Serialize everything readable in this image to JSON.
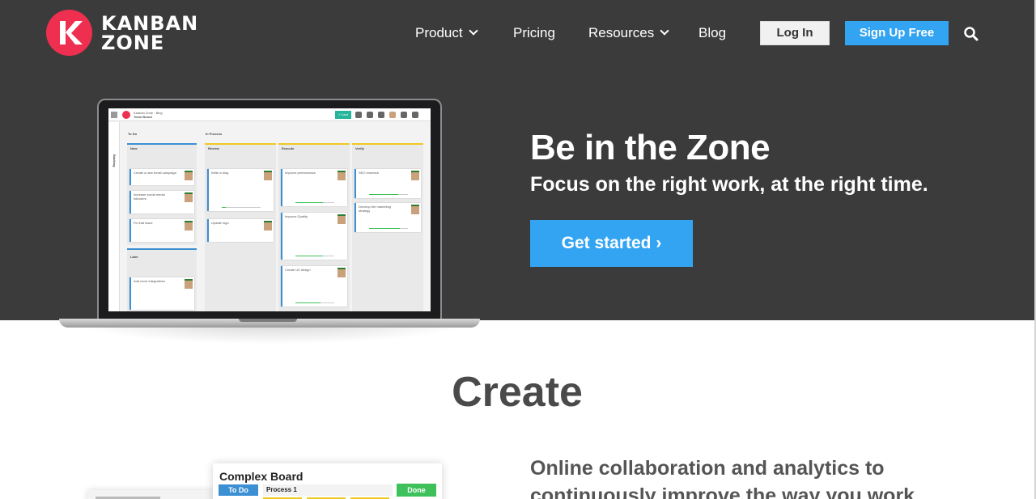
{
  "brand": {
    "name_line1": "KANBAN",
    "name_line2": "ZONE",
    "accent": "#ee2f4f"
  },
  "nav": {
    "items": [
      {
        "label": "Product",
        "dropdown": true
      },
      {
        "label": "Pricing",
        "dropdown": false
      },
      {
        "label": "Resources",
        "dropdown": true
      },
      {
        "label": "Blog",
        "dropdown": false
      }
    ],
    "login_label": "Log In",
    "signup_label": "Sign Up Free",
    "search_icon": "search-icon"
  },
  "hero": {
    "title": "Be in the Zone",
    "subtitle": "Focus on the right work, at the right time.",
    "cta_label": "Get started ›",
    "bg_color": "#3b3b3c",
    "cta_color": "#33a4f2"
  },
  "mock_app": {
    "breadcrumb": "Kanban Zone  ·  Blog",
    "board_title": "Team Board",
    "add_card_label": "+ Card",
    "lane_todo": "To Do",
    "lane_inprocess": "In Process",
    "backlog_label": "Backlog",
    "columns": [
      {
        "name": "Now",
        "cards": [
          "Create a new email campaign",
          "Increase social media followers",
          "Fix that issue"
        ]
      },
      {
        "name": "Later",
        "cards": [
          "Add more integrations"
        ]
      },
      {
        "name": "Review",
        "cards": [
          "Write a blog",
          "Update logo"
        ]
      },
      {
        "name": "Execute",
        "cards": [
          "Improve performance",
          "Improve Quality",
          "Create UX design"
        ]
      },
      {
        "name": "Verify",
        "cards": [
          "SEO research",
          "Develop the marketing strategy"
        ]
      }
    ]
  },
  "create": {
    "title": "Create",
    "text": "Online collaboration and analytics to continuously improve the way you work."
  },
  "complex_board": {
    "title": "Complex Board",
    "todo_label": "To Do",
    "process_label": "Process 1",
    "done_label": "Done"
  }
}
